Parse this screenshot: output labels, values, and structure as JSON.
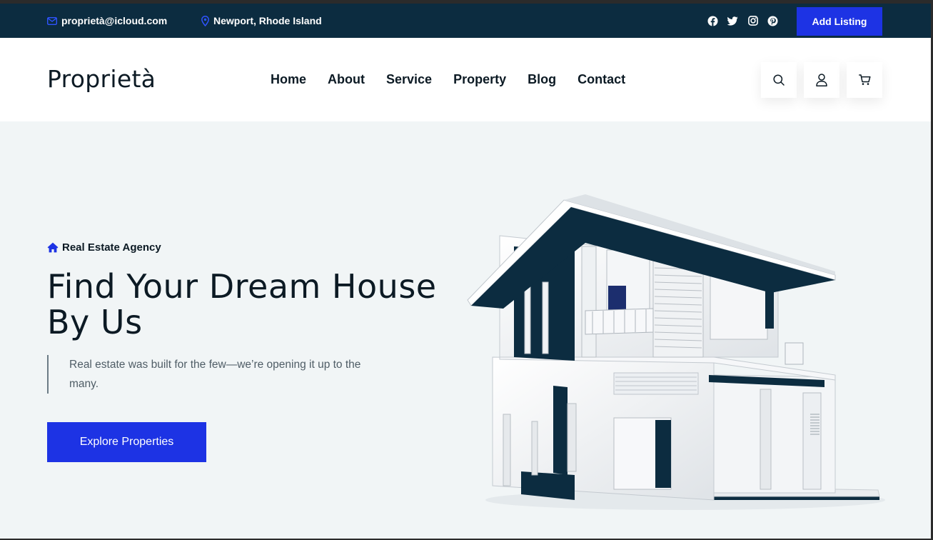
{
  "topbar": {
    "email": "proprietà@icloud.com",
    "location": "Newport, Rhode Island",
    "socials": [
      "facebook-icon",
      "twitter-icon",
      "instagram-icon",
      "pinterest-icon"
    ],
    "add_listing_label": "Add Listing"
  },
  "header": {
    "logo": "Proprietà",
    "nav": [
      "Home",
      "About",
      "Service",
      "Property",
      "Blog",
      "Contact"
    ],
    "icons": [
      "search-icon",
      "user-icon",
      "cart-icon"
    ]
  },
  "hero": {
    "eyebrow": "Real Estate Agency",
    "title_line1": "Find Your Dream House",
    "title_line2": "By Us",
    "description": "Real estate was built for the few—we’re opening it up to the many.",
    "cta_label": "Explore Properties"
  },
  "colors": {
    "accent": "#1d33e4",
    "navy": "#0c2c40",
    "hero_bg": "#f1f5f6",
    "text_dark": "#0c1a24"
  }
}
